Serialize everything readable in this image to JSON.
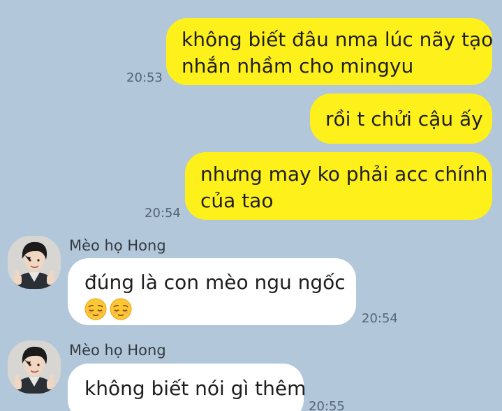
{
  "conversation": {
    "messages": [
      {
        "direction": "outgoing",
        "lines": [
          "không biết đâu nma lúc nãy tạo",
          "nhắn nhầm cho mingyu"
        ],
        "time": "20:53"
      },
      {
        "direction": "outgoing",
        "lines": [
          "rồi t chửi cậu ấy"
        ]
      },
      {
        "direction": "outgoing",
        "lines": [
          "nhưng may ko phải acc chính",
          "của tao"
        ],
        "time": "20:54"
      },
      {
        "direction": "incoming",
        "sender": "Mèo họ Hong",
        "lines": [
          "đúng là con mèo ngu ngốc"
        ],
        "emojis": [
          "relieved-face",
          "relieved-face"
        ],
        "time": "20:54"
      },
      {
        "direction": "incoming",
        "sender": "Mèo họ Hong",
        "lines": [
          "không biết nói gì thêm"
        ],
        "time": "20:55"
      }
    ]
  },
  "colors": {
    "background": "#b2c7da",
    "outgoing_bubble": "#fef01b",
    "incoming_bubble": "#ffffff",
    "timestamp": "#556574"
  },
  "icons": {
    "avatar": "profile-photo-thumbs-up",
    "emoji": "relieved-face-emoji"
  }
}
